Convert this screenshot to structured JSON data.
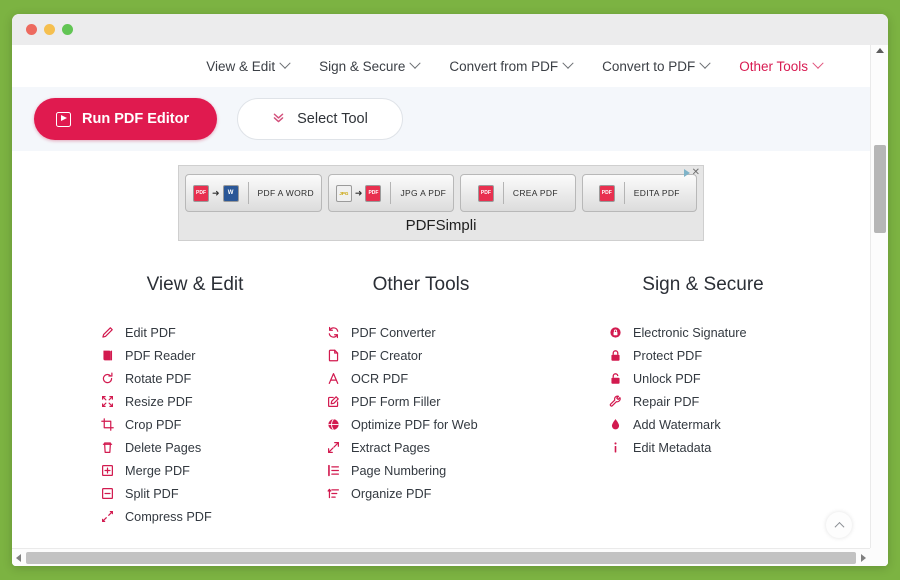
{
  "window": {
    "traffic_lights": [
      "close",
      "minimize",
      "maximize"
    ],
    "colors": {
      "desktop_background": "#7cb342",
      "titlebar": "#ececed",
      "accent": "#e01a4f",
      "accent_text": "#d81b52",
      "toolband": "#f4f7fb"
    }
  },
  "nav": {
    "items": [
      {
        "label": "View & Edit",
        "active": false,
        "caret": "chevron-down-icon"
      },
      {
        "label": "Sign & Secure",
        "active": false,
        "caret": "chevron-down-icon"
      },
      {
        "label": "Convert from PDF",
        "active": false,
        "caret": "chevron-down-icon"
      },
      {
        "label": "Convert to PDF",
        "active": false,
        "caret": "chevron-down-icon"
      },
      {
        "label": "Other Tools",
        "active": true,
        "caret": "chevron-down-icon"
      }
    ]
  },
  "toolbar": {
    "run_editor_label": "Run PDF Editor",
    "run_editor_icon": "video-play-icon",
    "select_tool_label": "Select Tool",
    "select_tool_icon": "double-chevron-down-icon"
  },
  "ad": {
    "brand": "PDFSimpli",
    "adchoices_icon": "adchoices-triangle-icon",
    "close_icon": "close-icon",
    "close_glyph": "✕",
    "arrow_glyph": "➜",
    "cells": [
      {
        "label": "PDF A WORD",
        "from": "PDF",
        "to": "W"
      },
      {
        "label": "JPG A PDF",
        "from": "JPG",
        "to": "PDF"
      },
      {
        "label": "CREA PDF",
        "from": "PDF",
        "to": ""
      },
      {
        "label": "EDITA PDF",
        "from": "PDF",
        "to": ""
      }
    ]
  },
  "columns": [
    {
      "title": "View & Edit",
      "items": [
        {
          "label": "Edit PDF",
          "icon": "pencil-icon"
        },
        {
          "label": "PDF Reader",
          "icon": "book-icon"
        },
        {
          "label": "Rotate PDF",
          "icon": "rotate-icon"
        },
        {
          "label": "Resize PDF",
          "icon": "resize-arrows-icon"
        },
        {
          "label": "Crop PDF",
          "icon": "crop-icon"
        },
        {
          "label": "Delete Pages",
          "icon": "trash-icon"
        },
        {
          "label": "Merge PDF",
          "icon": "merge-plus-square-icon"
        },
        {
          "label": "Split PDF",
          "icon": "split-minus-square-icon"
        },
        {
          "label": "Compress PDF",
          "icon": "compress-arrows-icon"
        }
      ]
    },
    {
      "title": "Other Tools",
      "items": [
        {
          "label": "PDF Converter",
          "icon": "refresh-cycle-icon"
        },
        {
          "label": "PDF Creator",
          "icon": "file-new-icon"
        },
        {
          "label": "OCR PDF",
          "icon": "letter-a-icon"
        },
        {
          "label": "PDF Form Filler",
          "icon": "form-edit-icon"
        },
        {
          "label": "Optimize PDF for Web",
          "icon": "globe-icon"
        },
        {
          "label": "Extract Pages",
          "icon": "expand-arrows-icon"
        },
        {
          "label": "Page Numbering",
          "icon": "list-numbered-icon"
        },
        {
          "label": "Organize PDF",
          "icon": "sort-list-icon"
        }
      ]
    },
    {
      "title": "Sign & Secure",
      "items": [
        {
          "label": "Electronic Signature",
          "icon": "lock-circle-icon"
        },
        {
          "label": "Protect PDF",
          "icon": "lock-closed-icon"
        },
        {
          "label": "Unlock PDF",
          "icon": "lock-open-icon"
        },
        {
          "label": "Repair PDF",
          "icon": "wrench-icon"
        },
        {
          "label": "Add Watermark",
          "icon": "droplet-icon"
        },
        {
          "label": "Edit Metadata",
          "icon": "info-icon"
        }
      ]
    }
  ],
  "scroll_top_button": {
    "icon": "chevron-up-icon",
    "label": ""
  },
  "scrollbars": {
    "vertical_icon": "scrollbar-vertical",
    "horizontal_icon": "scrollbar-horizontal"
  }
}
